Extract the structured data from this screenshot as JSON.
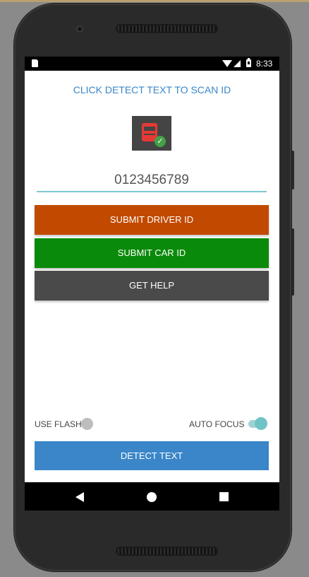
{
  "status_bar": {
    "time": "8:33"
  },
  "header": {
    "instruction": "CLICK DETECT TEXT TO SCAN ID"
  },
  "id_field": {
    "value": "0123456789"
  },
  "buttons": {
    "submit_driver": "SUBMIT DRIVER ID",
    "submit_car": "SUBMIT CAR ID",
    "get_help": "GET HELP",
    "detect_text": "DETECT TEXT"
  },
  "toggles": {
    "flash_label": "USE FLASH",
    "flash_on": false,
    "focus_label": "AUTO FOCUS",
    "focus_on": true
  },
  "colors": {
    "accent": "#3a86c8",
    "driver_button": "#c24a00",
    "car_button": "#0a8a0a",
    "help_button": "#4a4a4a",
    "toggle_on": "#6ec3c5"
  },
  "icons": [
    "sd-card-icon",
    "wifi-icon",
    "signal-icon",
    "battery-icon",
    "truck-check-icon",
    "back-icon",
    "home-icon",
    "recents-icon"
  ]
}
